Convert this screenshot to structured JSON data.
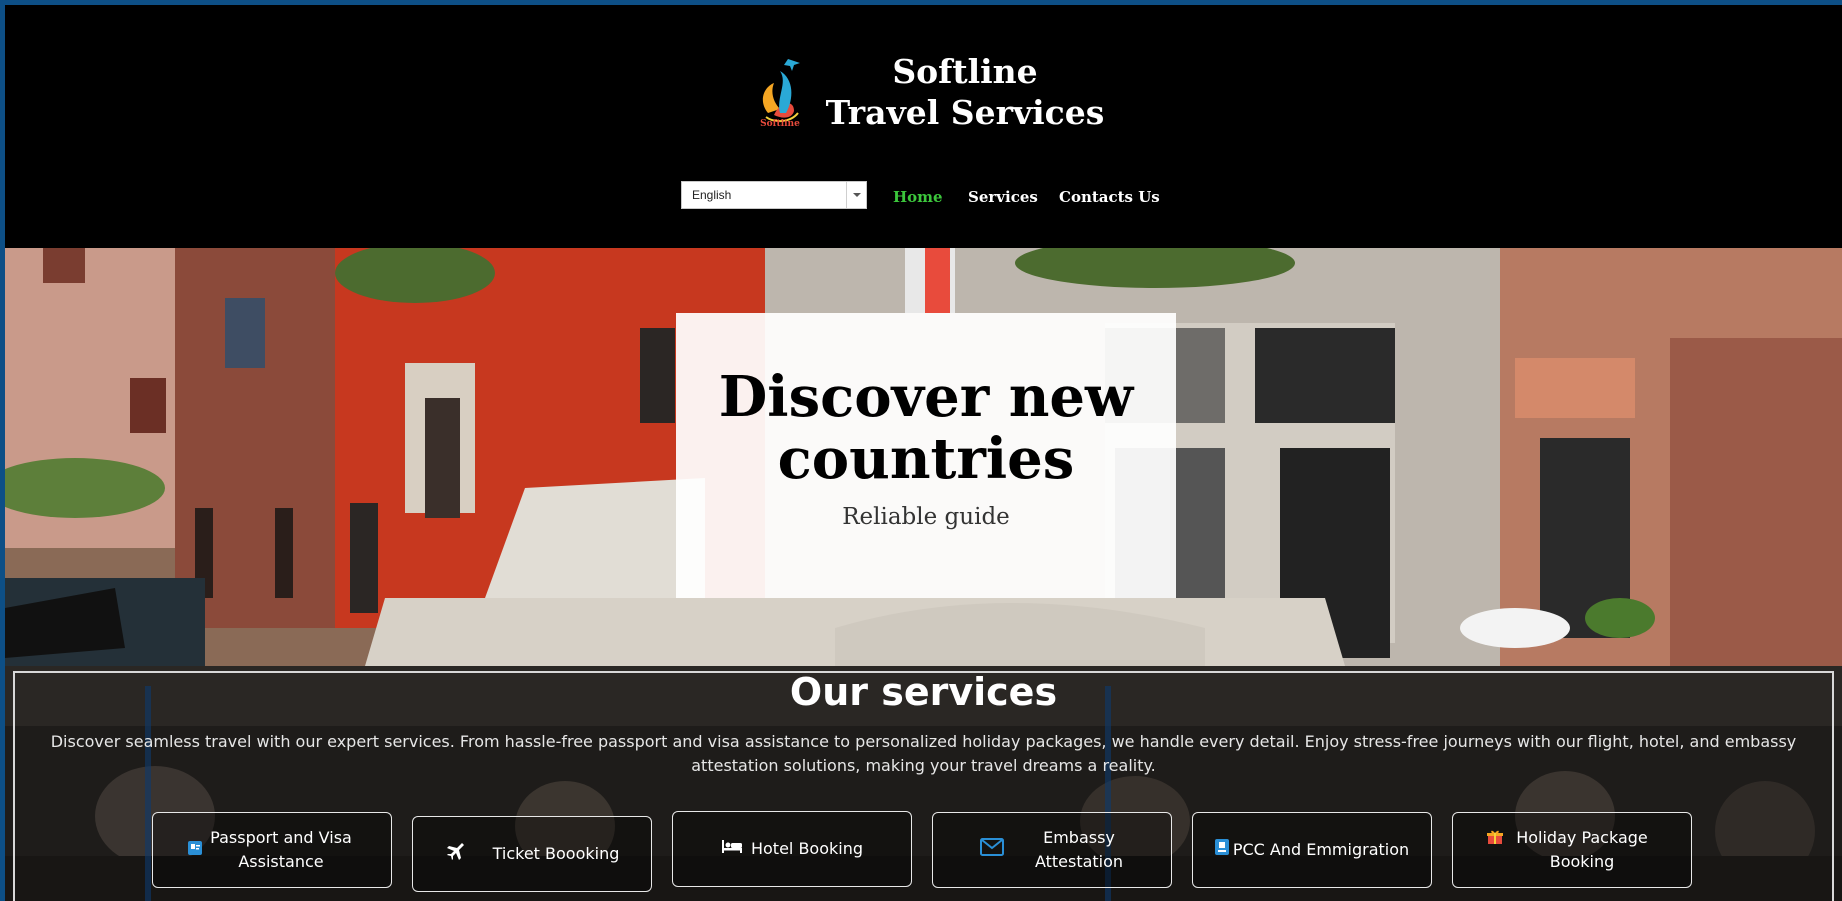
{
  "brand": {
    "logo_text": "Softline",
    "name_line1": "Softline",
    "name_line2": "Travel Services"
  },
  "language_select": {
    "value": "English"
  },
  "nav": {
    "home": "Home",
    "services": "Services",
    "contacts": "Contacts Us",
    "active_color": "#3cc63c"
  },
  "hero": {
    "title_line1": "Discover new",
    "title_line2": "countries",
    "subtitle": "Reliable guide"
  },
  "services": {
    "title": "Our services",
    "description": "Discover seamless travel with our expert services. From hassle-free passport and visa assistance to personalized holiday packages, we handle every detail. Enjoy stress-free journeys with our flight, hotel, and embassy attestation solutions, making your travel dreams a reality.",
    "items": [
      {
        "label": "Passport and Visa Assistance",
        "icon": "passport-icon"
      },
      {
        "label": "Ticket Boooking",
        "icon": "airplane-icon"
      },
      {
        "label": "Hotel Booking",
        "icon": "bed-icon"
      },
      {
        "label": "Embassy Attestation",
        "icon": "envelope-icon"
      },
      {
        "label": "PCC And Emmigration",
        "icon": "id-card-icon"
      },
      {
        "label": "Holiday Package Booking",
        "icon": "gift-icon"
      }
    ]
  },
  "colors": {
    "outer_frame": "#0d4f86",
    "header_bg": "#000000",
    "accent_green": "#3cc63c"
  }
}
